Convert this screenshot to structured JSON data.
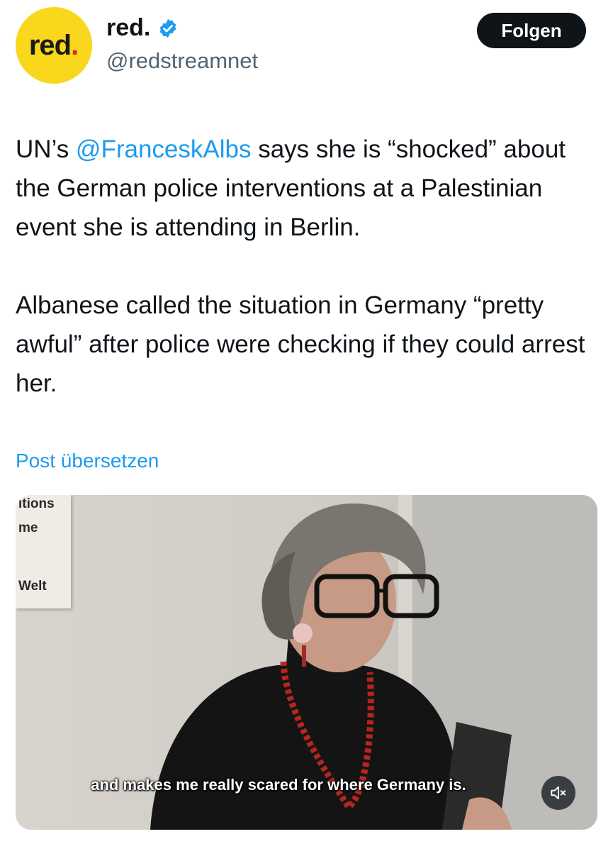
{
  "author": {
    "avatar_text": "red",
    "avatar_dot": ".",
    "display_name": "red.",
    "handle": "@redstreamnet",
    "verified_icon": "verified-badge-icon"
  },
  "follow_button": {
    "label": "Folgen"
  },
  "tweet": {
    "p1_before": "UN’s ",
    "p1_mention": "@FranceskAlbs",
    "p1_after": " says she is “shocked” about the German police interventions at a Palestinian event she is attending in Berlin.",
    "p2": "Albanese called the situation in Germany “pretty awful” after police were checking if they could arrest her."
  },
  "translate_link": "Post übersetzen",
  "media": {
    "poster_lines": [
      "ıtions",
      "me",
      "Welt"
    ],
    "subtitle": "and makes me really scared for where Germany is.",
    "mute_icon": "speaker-muted-icon"
  },
  "colors": {
    "accent": "#1d9bf0",
    "text": "#0f1419",
    "secondary": "#536471",
    "avatar_bg": "#f9d71c",
    "avatar_dot": "#e2231a"
  }
}
